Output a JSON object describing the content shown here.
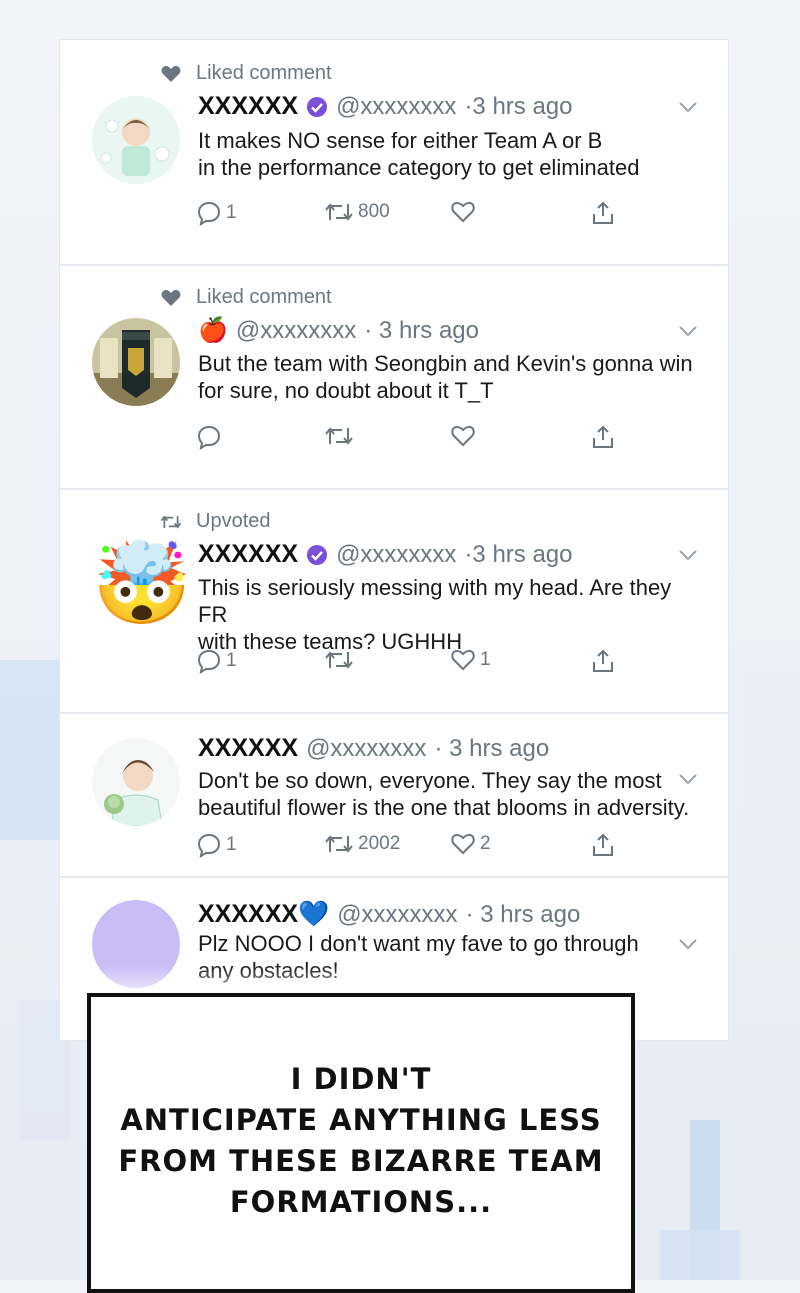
{
  "feed": {
    "tweets": [
      {
        "context_icon": "heart-icon",
        "context_label": "Liked comment",
        "name": "XXXXXX",
        "verified": true,
        "handle": "@xxxxxxxx",
        "time": "·3 hrs ago",
        "body_line1": "It makes NO sense for either Team A or B",
        "body_line2": "in the performance category to get eliminated",
        "reply_count": "1",
        "retweet_count": "800",
        "like_count": ""
      },
      {
        "context_icon": "heart-icon",
        "context_label": "Liked comment",
        "name": "",
        "apple_emoji": "🍎",
        "handle": "@xxxxxxxx",
        "time": "· 3 hrs ago",
        "body_line1": "But the team with Seongbin and Kevin's gonna win",
        "body_line2": "for sure, no doubt about it T_T",
        "reply_count": "",
        "retweet_count": "",
        "like_count": ""
      },
      {
        "context_icon": "retweet-icon",
        "context_label": "Upvoted",
        "name": "XXXXXX",
        "verified": true,
        "handle": "@xxxxxxxx",
        "time": "·3 hrs ago",
        "body_line1": "This is seriously messing with my head. Are they FR",
        "body_line2": "with these teams? UGHHH",
        "reply_count": "1",
        "retweet_count": "",
        "like_count": "1",
        "avatar_emoji": "🤯"
      },
      {
        "name": "XXXXXX",
        "handle": "@xxxxxxxx",
        "time": "· 3 hrs ago",
        "body_line1": "Don't be so down, everyone. They say the most",
        "body_line2": "beautiful flower is the one that blooms in adversity.",
        "reply_count": "1",
        "retweet_count": "2002",
        "like_count": "2"
      },
      {
        "name": "XXXXXX💙",
        "handle": "@xxxxxxxx",
        "time": "· 3 hrs ago",
        "body_line1": "Plz NOOO I don't want my fave to go through",
        "body_line2": "any obstacles!"
      }
    ]
  },
  "caption": {
    "text": "I DIDN'T\nANTICIPATE ANYTHING LESS\nFROM THESE BIZARRE TEAM\nFORMATIONS..."
  },
  "colors": {
    "verified": "#7b4fd6",
    "muted": "#6b7682",
    "avatar_purple": "#c9bdf6"
  }
}
